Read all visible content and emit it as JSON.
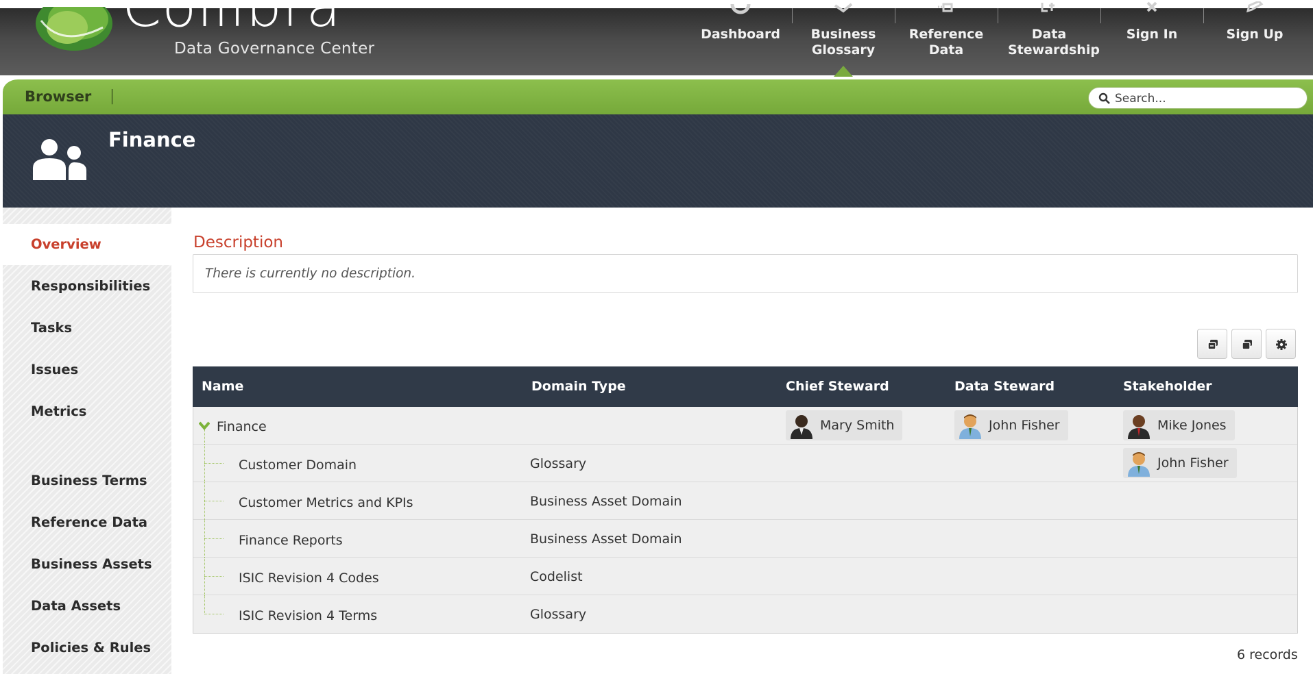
{
  "brand": {
    "name": "Collibra",
    "subtitle": "Data Governance Center"
  },
  "nav": [
    {
      "label": "Dashboard",
      "icon": "dashboard-icon"
    },
    {
      "label": "Business Glossary",
      "icon": "glossary-icon",
      "active": true
    },
    {
      "label": "Reference Data",
      "icon": "reference-data-icon"
    },
    {
      "label": "Data Stewardship",
      "icon": "stewardship-icon"
    },
    {
      "label": "Sign In",
      "icon": "sign-in-icon"
    },
    {
      "label": "Sign Up",
      "icon": "sign-up-icon"
    }
  ],
  "toolbar": {
    "browser_label": "Browser",
    "separator": "|",
    "search_placeholder": "Search..."
  },
  "banner": {
    "title": "Finance",
    "icon": "community-icon"
  },
  "sidebar": {
    "items": [
      {
        "label": "Overview",
        "active": true
      },
      {
        "label": "Responsibilities"
      },
      {
        "label": "Tasks"
      },
      {
        "label": "Issues"
      },
      {
        "label": "Metrics"
      },
      {
        "label": "Business Terms"
      },
      {
        "label": "Reference Data"
      },
      {
        "label": "Business Assets"
      },
      {
        "label": "Data Assets"
      },
      {
        "label": "Policies & Rules"
      }
    ]
  },
  "description": {
    "heading": "Description",
    "text": "There is currently no description."
  },
  "table": {
    "columns": [
      "Name",
      "Domain Type",
      "Chief Steward",
      "Data Steward",
      "Stakeholder"
    ],
    "rows": [
      {
        "name": "Finance",
        "domain_type": "",
        "chief_steward": "Mary Smith",
        "data_steward": "John Fisher",
        "stakeholder": "Mike Jones"
      },
      {
        "name": "Customer Domain",
        "domain_type": "Glossary",
        "chief_steward": "",
        "data_steward": "",
        "stakeholder": "John Fisher"
      },
      {
        "name": "Customer Metrics and KPIs",
        "domain_type": "Business Asset Domain",
        "chief_steward": "",
        "data_steward": "",
        "stakeholder": ""
      },
      {
        "name": "Finance Reports",
        "domain_type": "Business Asset Domain",
        "chief_steward": "",
        "data_steward": "",
        "stakeholder": ""
      },
      {
        "name": "ISIC Revision 4 Codes",
        "domain_type": "Codelist",
        "chief_steward": "",
        "data_steward": "",
        "stakeholder": ""
      },
      {
        "name": "ISIC Revision 4 Terms",
        "domain_type": "Glossary",
        "chief_steward": "",
        "data_steward": "",
        "stakeholder": ""
      }
    ],
    "record_count": "6 records"
  },
  "colors": {
    "accent_green": "#79aa3e",
    "header_dark": "#303a48",
    "active_red": "#c8402c"
  }
}
